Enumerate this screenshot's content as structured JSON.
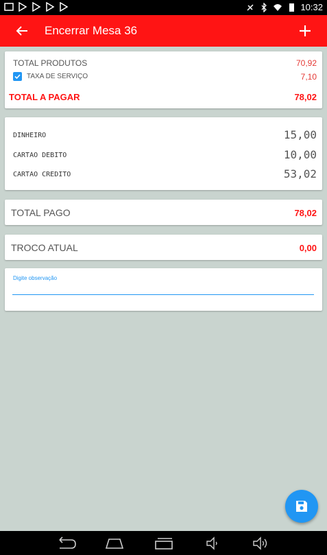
{
  "status_bar": {
    "time": "10:32",
    "left_icons": [
      "screenshot-icon",
      "play-store-icon",
      "play-store-icon",
      "play-store-icon",
      "play-store-icon"
    ],
    "right_icons": [
      "mute-icon",
      "bluetooth-icon",
      "wifi-icon",
      "battery-icon"
    ]
  },
  "app_bar": {
    "title": "Encerrar Mesa 36",
    "back_icon": "arrow-left-icon",
    "add_icon": "plus-icon",
    "color": "#ff1414"
  },
  "summary": {
    "total_produtos_label": "TOTAL PRODUTOS",
    "total_produtos_value": "70,92",
    "taxa_label": "TAXA DE SERVIÇO",
    "taxa_value": "7,10",
    "taxa_checked": true,
    "total_pagar_label": "TOTAL A PAGAR",
    "total_pagar_value": "78,02"
  },
  "payments": [
    {
      "label": "DINHEIRO",
      "value": "15,00"
    },
    {
      "label": "CARTAO DEBITO",
      "value": "10,00"
    },
    {
      "label": "CARTAO CREDITO",
      "value": "53,02"
    }
  ],
  "total_pago": {
    "label": "TOTAL PAGO",
    "value": "78,02"
  },
  "troco": {
    "label": "TROCO ATUAL",
    "value": "0,00"
  },
  "observacao": {
    "placeholder": "Digite observação",
    "value": ""
  },
  "fab": {
    "icon": "save-icon",
    "color": "#2196f3"
  },
  "nav_bar": {
    "icons": [
      "back-icon",
      "home-icon",
      "recents-icon",
      "volume-down-icon",
      "volume-up-icon"
    ]
  }
}
